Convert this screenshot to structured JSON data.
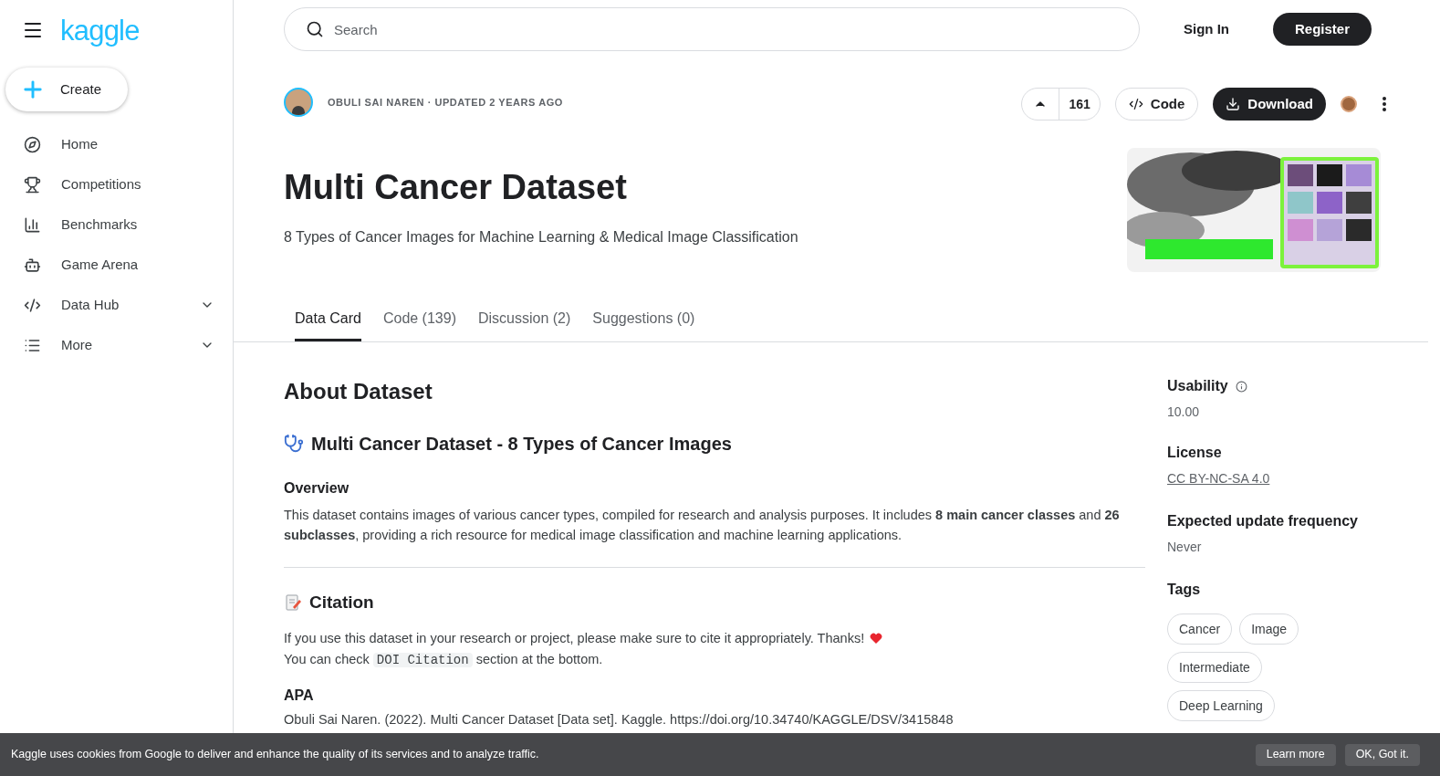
{
  "logo": "kaggle",
  "create_button": "Create",
  "nav": [
    {
      "label": "Home",
      "expandable": false
    },
    {
      "label": "Competitions",
      "expandable": false
    },
    {
      "label": "Benchmarks",
      "expandable": false
    },
    {
      "label": "Game Arena",
      "expandable": false
    },
    {
      "label": "Data Hub",
      "expandable": true
    },
    {
      "label": "More",
      "expandable": true
    }
  ],
  "search": {
    "placeholder": "Search"
  },
  "auth": {
    "sign_in": "Sign In",
    "register": "Register"
  },
  "dataset": {
    "byline": "OBULI SAI NAREN · UPDATED 2 YEARS AGO",
    "upvotes": "161",
    "code_button": "Code",
    "download_button": "Download",
    "title": "Multi Cancer Dataset",
    "subtitle": "8 Types of Cancer Images for Machine Learning & Medical Image Classification"
  },
  "tabs": [
    {
      "label": "Data Card",
      "selected": true
    },
    {
      "label": "Code (139)",
      "selected": false
    },
    {
      "label": "Discussion (2)",
      "selected": false
    },
    {
      "label": "Suggestions (0)",
      "selected": false
    }
  ],
  "about": {
    "heading": "About Dataset",
    "section_title": "Multi Cancer Dataset - 8 Types of Cancer Images",
    "overview_heading": "Overview",
    "overview_text": "This dataset contains images of various cancer types, compiled for research and analysis purposes. It includes **8 main cancer classes** and **26 subclasses**, providing a rich resource for medical image classification and machine learning applications.",
    "citation_heading": "Citation",
    "citation_text": "If you use this dataset in your research or project, please make sure to cite it appropriately. Thanks!",
    "check_before": "You can check",
    "check_code": "DOI Citation",
    "check_after": "section at the bottom.",
    "apa_heading": "APA",
    "apa_text": "Obuli Sai Naren. (2022). Multi Cancer Dataset [Data set]. Kaggle. https://doi.org/10.34740/KAGGLE/DSV/3415848"
  },
  "sidebar_meta": {
    "usability_label": "Usability",
    "usability_value": "10.00",
    "license_label": "License",
    "license_value": "CC BY-NC-SA 4.0",
    "frequency_label": "Expected update frequency",
    "frequency_value": "Never",
    "tags_label": "Tags",
    "tags": [
      "Cancer",
      "Image",
      "Intermediate",
      "Deep Learning"
    ]
  },
  "cookie_banner": {
    "text": "Kaggle uses cookies from Google to deliver and enhance the quality of its services and to analyze traffic.",
    "learn_more": "Learn more",
    "ok": "OK, Got it."
  }
}
